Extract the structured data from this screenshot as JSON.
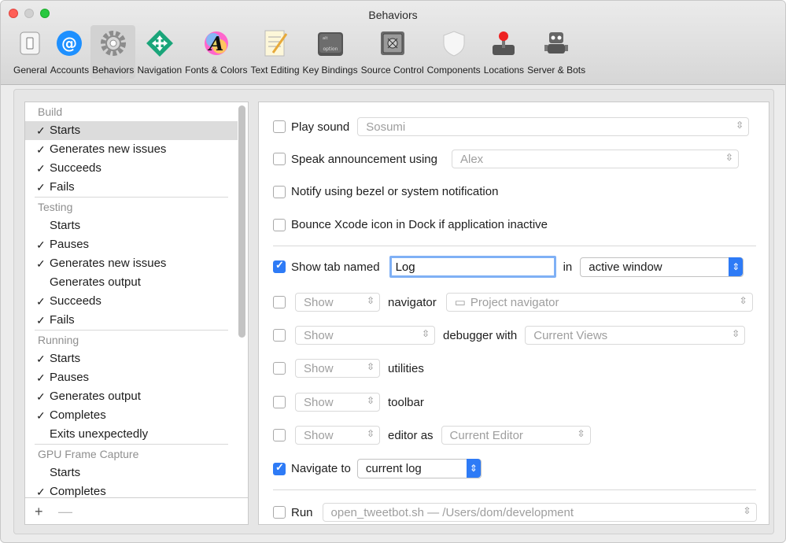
{
  "window": {
    "title": "Behaviors"
  },
  "toolbar": [
    {
      "label": "General",
      "icon": "switch-icon"
    },
    {
      "label": "Accounts",
      "icon": "at-icon"
    },
    {
      "label": "Behaviors",
      "icon": "gear-icon",
      "selected": true
    },
    {
      "label": "Navigation",
      "icon": "arrows-icon"
    },
    {
      "label": "Fonts & Colors",
      "icon": "font-icon"
    },
    {
      "label": "Text Editing",
      "icon": "notepad-icon"
    },
    {
      "label": "Key Bindings",
      "icon": "option-key-icon"
    },
    {
      "label": "Source Control",
      "icon": "safe-icon"
    },
    {
      "label": "Components",
      "icon": "shield-icon"
    },
    {
      "label": "Locations",
      "icon": "joystick-icon"
    },
    {
      "label": "Server & Bots",
      "icon": "robot-icon"
    }
  ],
  "sidebar": {
    "groups": [
      {
        "title": "Build",
        "items": [
          {
            "label": "Starts",
            "checked": true,
            "selected": true
          },
          {
            "label": "Generates new issues",
            "checked": true
          },
          {
            "label": "Succeeds",
            "checked": true
          },
          {
            "label": "Fails",
            "checked": true
          }
        ]
      },
      {
        "title": "Testing",
        "items": [
          {
            "label": "Starts",
            "checked": false
          },
          {
            "label": "Pauses",
            "checked": true
          },
          {
            "label": "Generates new issues",
            "checked": true
          },
          {
            "label": "Generates output",
            "checked": false
          },
          {
            "label": "Succeeds",
            "checked": true
          },
          {
            "label": "Fails",
            "checked": true
          }
        ]
      },
      {
        "title": "Running",
        "items": [
          {
            "label": "Starts",
            "checked": true
          },
          {
            "label": "Pauses",
            "checked": true
          },
          {
            "label": "Generates output",
            "checked": true
          },
          {
            "label": "Completes",
            "checked": true
          },
          {
            "label": "Exits unexpectedly",
            "checked": false
          }
        ]
      },
      {
        "title": "GPU Frame Capture",
        "items": [
          {
            "label": "Starts",
            "checked": false
          },
          {
            "label": "Completes",
            "checked": true
          }
        ]
      }
    ],
    "add_label": "+",
    "remove_label": "—"
  },
  "panel": {
    "play_sound": {
      "label": "Play sound",
      "value": "Sosumi",
      "checked": false
    },
    "speak": {
      "label": "Speak announcement using",
      "value": "Alex",
      "checked": false
    },
    "notify": {
      "label": "Notify using bezel or system notification",
      "checked": false
    },
    "bounce": {
      "label": "Bounce Xcode icon in Dock if application inactive",
      "checked": false
    },
    "show_tab": {
      "label": "Show tab named",
      "value": "Log",
      "in_label": "in",
      "window_value": "active window",
      "checked": true
    },
    "navigator": {
      "show": "Show",
      "label": "navigator",
      "value": "Project navigator",
      "checked": false
    },
    "debugger": {
      "show": "Show",
      "label": "debugger with",
      "value": "Current Views",
      "checked": false
    },
    "utilities": {
      "show": "Show",
      "label": "utilities",
      "checked": false
    },
    "toolbar_row": {
      "show": "Show",
      "label": "toolbar",
      "checked": false
    },
    "editor": {
      "show": "Show",
      "label": "editor as",
      "value": "Current Editor",
      "checked": false
    },
    "navigate": {
      "label": "Navigate to",
      "value": "current log",
      "checked": true
    },
    "run": {
      "label": "Run",
      "value": "open_tweetbot.sh — /Users/dom/development",
      "checked": false
    }
  },
  "colors": {
    "accent": "#2e7bf6"
  }
}
